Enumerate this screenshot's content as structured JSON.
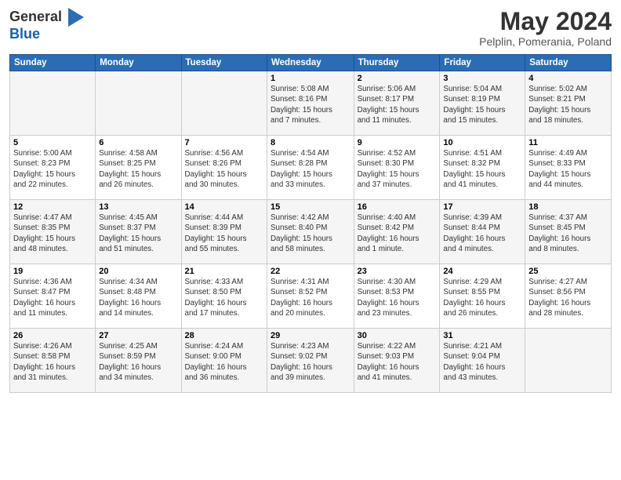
{
  "logo": {
    "general": "General",
    "blue": "Blue"
  },
  "title": "May 2024",
  "subtitle": "Pelplin, Pomerania, Poland",
  "days_header": [
    "Sunday",
    "Monday",
    "Tuesday",
    "Wednesday",
    "Thursday",
    "Friday",
    "Saturday"
  ],
  "weeks": [
    [
      {
        "day": "",
        "info": ""
      },
      {
        "day": "",
        "info": ""
      },
      {
        "day": "",
        "info": ""
      },
      {
        "day": "1",
        "info": "Sunrise: 5:08 AM\nSunset: 8:16 PM\nDaylight: 15 hours\nand 7 minutes."
      },
      {
        "day": "2",
        "info": "Sunrise: 5:06 AM\nSunset: 8:17 PM\nDaylight: 15 hours\nand 11 minutes."
      },
      {
        "day": "3",
        "info": "Sunrise: 5:04 AM\nSunset: 8:19 PM\nDaylight: 15 hours\nand 15 minutes."
      },
      {
        "day": "4",
        "info": "Sunrise: 5:02 AM\nSunset: 8:21 PM\nDaylight: 15 hours\nand 18 minutes."
      }
    ],
    [
      {
        "day": "5",
        "info": "Sunrise: 5:00 AM\nSunset: 8:23 PM\nDaylight: 15 hours\nand 22 minutes."
      },
      {
        "day": "6",
        "info": "Sunrise: 4:58 AM\nSunset: 8:25 PM\nDaylight: 15 hours\nand 26 minutes."
      },
      {
        "day": "7",
        "info": "Sunrise: 4:56 AM\nSunset: 8:26 PM\nDaylight: 15 hours\nand 30 minutes."
      },
      {
        "day": "8",
        "info": "Sunrise: 4:54 AM\nSunset: 8:28 PM\nDaylight: 15 hours\nand 33 minutes."
      },
      {
        "day": "9",
        "info": "Sunrise: 4:52 AM\nSunset: 8:30 PM\nDaylight: 15 hours\nand 37 minutes."
      },
      {
        "day": "10",
        "info": "Sunrise: 4:51 AM\nSunset: 8:32 PM\nDaylight: 15 hours\nand 41 minutes."
      },
      {
        "day": "11",
        "info": "Sunrise: 4:49 AM\nSunset: 8:33 PM\nDaylight: 15 hours\nand 44 minutes."
      }
    ],
    [
      {
        "day": "12",
        "info": "Sunrise: 4:47 AM\nSunset: 8:35 PM\nDaylight: 15 hours\nand 48 minutes."
      },
      {
        "day": "13",
        "info": "Sunrise: 4:45 AM\nSunset: 8:37 PM\nDaylight: 15 hours\nand 51 minutes."
      },
      {
        "day": "14",
        "info": "Sunrise: 4:44 AM\nSunset: 8:39 PM\nDaylight: 15 hours\nand 55 minutes."
      },
      {
        "day": "15",
        "info": "Sunrise: 4:42 AM\nSunset: 8:40 PM\nDaylight: 15 hours\nand 58 minutes."
      },
      {
        "day": "16",
        "info": "Sunrise: 4:40 AM\nSunset: 8:42 PM\nDaylight: 16 hours\nand 1 minute."
      },
      {
        "day": "17",
        "info": "Sunrise: 4:39 AM\nSunset: 8:44 PM\nDaylight: 16 hours\nand 4 minutes."
      },
      {
        "day": "18",
        "info": "Sunrise: 4:37 AM\nSunset: 8:45 PM\nDaylight: 16 hours\nand 8 minutes."
      }
    ],
    [
      {
        "day": "19",
        "info": "Sunrise: 4:36 AM\nSunset: 8:47 PM\nDaylight: 16 hours\nand 11 minutes."
      },
      {
        "day": "20",
        "info": "Sunrise: 4:34 AM\nSunset: 8:48 PM\nDaylight: 16 hours\nand 14 minutes."
      },
      {
        "day": "21",
        "info": "Sunrise: 4:33 AM\nSunset: 8:50 PM\nDaylight: 16 hours\nand 17 minutes."
      },
      {
        "day": "22",
        "info": "Sunrise: 4:31 AM\nSunset: 8:52 PM\nDaylight: 16 hours\nand 20 minutes."
      },
      {
        "day": "23",
        "info": "Sunrise: 4:30 AM\nSunset: 8:53 PM\nDaylight: 16 hours\nand 23 minutes."
      },
      {
        "day": "24",
        "info": "Sunrise: 4:29 AM\nSunset: 8:55 PM\nDaylight: 16 hours\nand 26 minutes."
      },
      {
        "day": "25",
        "info": "Sunrise: 4:27 AM\nSunset: 8:56 PM\nDaylight: 16 hours\nand 28 minutes."
      }
    ],
    [
      {
        "day": "26",
        "info": "Sunrise: 4:26 AM\nSunset: 8:58 PM\nDaylight: 16 hours\nand 31 minutes."
      },
      {
        "day": "27",
        "info": "Sunrise: 4:25 AM\nSunset: 8:59 PM\nDaylight: 16 hours\nand 34 minutes."
      },
      {
        "day": "28",
        "info": "Sunrise: 4:24 AM\nSunset: 9:00 PM\nDaylight: 16 hours\nand 36 minutes."
      },
      {
        "day": "29",
        "info": "Sunrise: 4:23 AM\nSunset: 9:02 PM\nDaylight: 16 hours\nand 39 minutes."
      },
      {
        "day": "30",
        "info": "Sunrise: 4:22 AM\nSunset: 9:03 PM\nDaylight: 16 hours\nand 41 minutes."
      },
      {
        "day": "31",
        "info": "Sunrise: 4:21 AM\nSunset: 9:04 PM\nDaylight: 16 hours\nand 43 minutes."
      },
      {
        "day": "",
        "info": ""
      }
    ]
  ]
}
